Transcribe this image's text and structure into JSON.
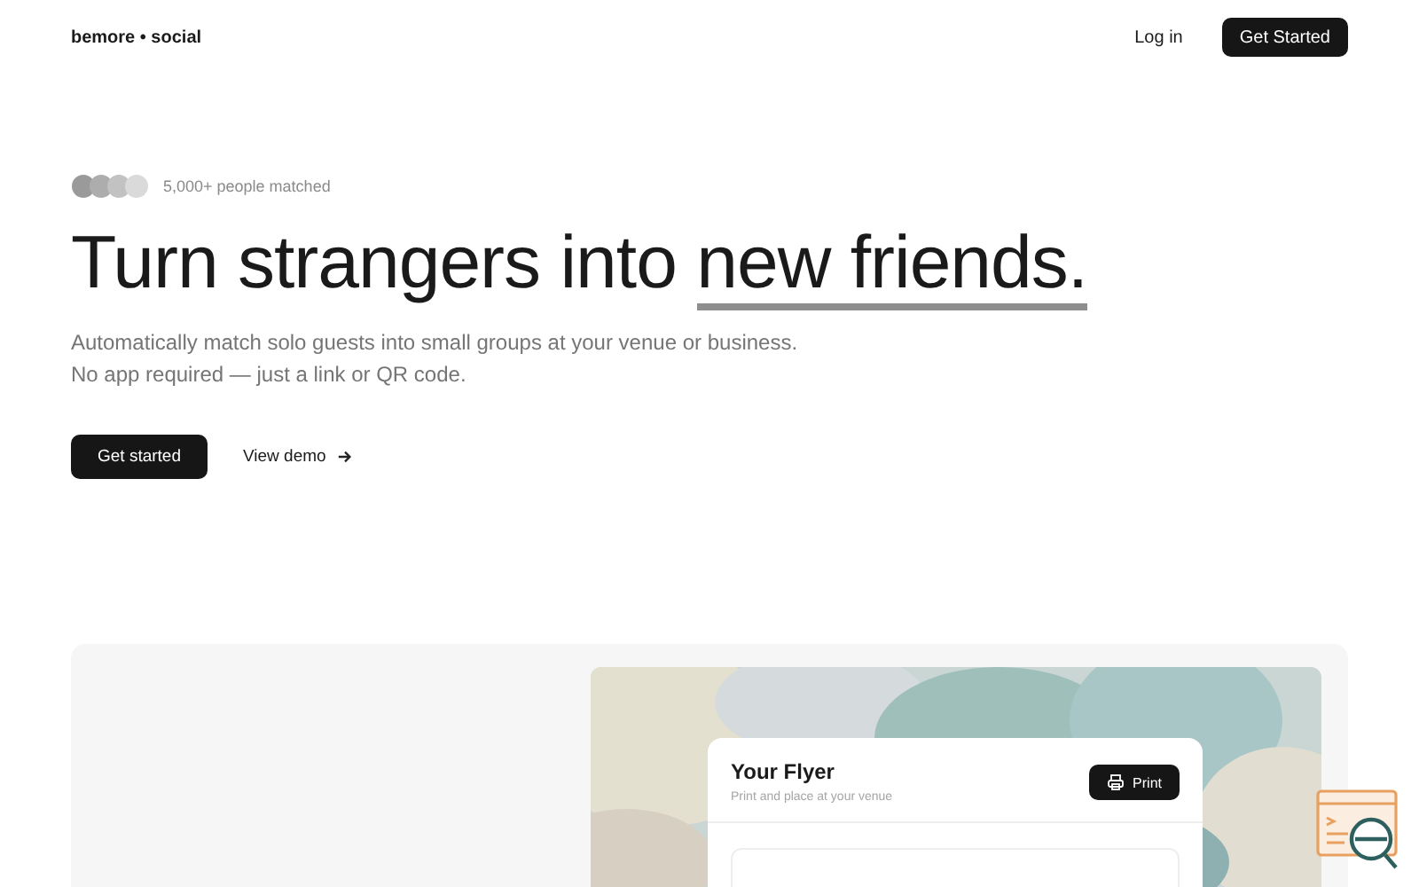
{
  "header": {
    "logo": "bemore • social",
    "login": "Log in",
    "cta": "Get Started"
  },
  "hero": {
    "social_proof": "5,000+ people matched",
    "headline": "Turn strangers into ",
    "headline_highlight": "new friends.",
    "subtitle_lines": [
      "Automatically match solo guests into small groups at your venue or business.",
      "No app required — just a link or QR code."
    ],
    "primary_button": "Get started",
    "secondary_link": "View demo"
  },
  "preview": {
    "card_title": "Your Flyer",
    "card_subtitle": "Print and place at your venue",
    "print_button": "Print"
  }
}
